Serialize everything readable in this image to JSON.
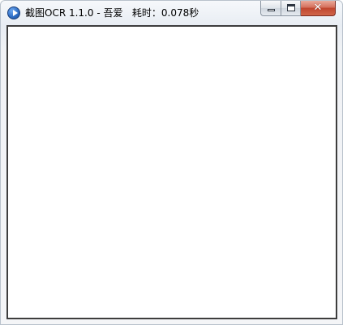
{
  "window": {
    "title": "截图OCR 1.1.0 - 吾爱   耗时：0.078秒"
  },
  "icons": {
    "app": "app-logo-icon",
    "minimize": "minimize-icon",
    "maximize": "maximize-icon",
    "close": "close-icon"
  },
  "caption": {
    "close_glyph": "✕"
  },
  "content": {
    "text": ""
  }
}
